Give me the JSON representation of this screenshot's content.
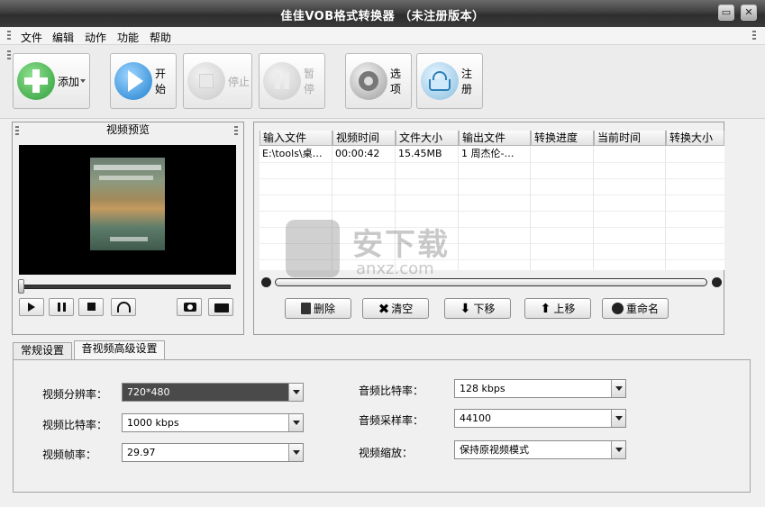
{
  "window": {
    "title": "佳佳VOB格式转换器 （未注册版本）",
    "minimize_glyph": "▭",
    "close_glyph": "✕"
  },
  "menu": [
    "文件",
    "编辑",
    "动作",
    "功能",
    "帮助"
  ],
  "toolbar": {
    "add": "添加",
    "start": "开始",
    "stop": "停止",
    "pause": "暂停",
    "options": "选项",
    "register": "注册"
  },
  "preview": {
    "title": "视频预览"
  },
  "file_table": {
    "columns": [
      "输入文件",
      "视频时间",
      "文件大小",
      "输出文件",
      "转换进度",
      "当前时间",
      "转换大小"
    ],
    "rows": [
      [
        "E:\\tools\\桌…",
        "00:00:42",
        "15.45MB",
        "1 周杰伦-…",
        "",
        "",
        ""
      ]
    ]
  },
  "actions": {
    "delete": "删除",
    "clear": "清空",
    "move_down": "下移",
    "move_up": "上移",
    "rename": "重命名"
  },
  "tabs": [
    "常规设置",
    "音视频高级设置"
  ],
  "settings": {
    "video_resolution_label": "视频分辨率：",
    "video_resolution": "720*480",
    "video_bitrate_label": "视频比特率：",
    "video_bitrate": "1000 kbps",
    "video_fps_label": "视频帧率：",
    "video_fps": "29.97",
    "audio_bitrate_label": "音频比特率：",
    "audio_bitrate": "128 kbps",
    "audio_samplerate_label": "音频采样率：",
    "audio_samplerate": "44100",
    "video_scale_label": "视频缩放：",
    "video_scale": "保持原视频模式"
  },
  "watermark": {
    "text_cn": "安下载",
    "text_en": "anxz.com"
  },
  "colors": {
    "titlebar": "#3e3e3e",
    "add_icon": "#3fae3f",
    "start_icon": "#2a8fd8",
    "selected_combo": "#4a4a4a"
  }
}
